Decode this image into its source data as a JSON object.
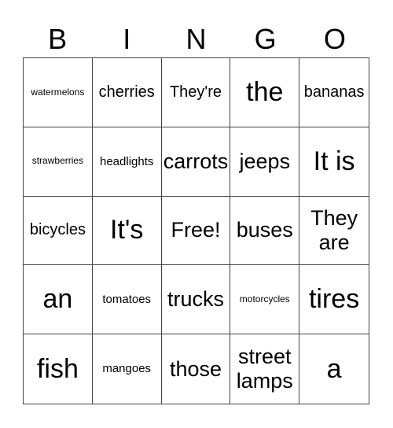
{
  "header": [
    "B",
    "I",
    "N",
    "G",
    "O"
  ],
  "cells": [
    {
      "text": "watermelons",
      "size": "xs"
    },
    {
      "text": "cherries",
      "size": "m"
    },
    {
      "text": "They're",
      "size": "m"
    },
    {
      "text": "the",
      "size": "xl"
    },
    {
      "text": "bananas",
      "size": "m"
    },
    {
      "text": "strawberries",
      "size": "xs"
    },
    {
      "text": "headlights",
      "size": "s"
    },
    {
      "text": "carrots",
      "size": "l"
    },
    {
      "text": "jeeps",
      "size": "l"
    },
    {
      "text": "It is",
      "size": "xl"
    },
    {
      "text": "bicycles",
      "size": "m"
    },
    {
      "text": "It's",
      "size": "xl"
    },
    {
      "text": "Free!",
      "size": "l"
    },
    {
      "text": "buses",
      "size": "l"
    },
    {
      "text": "They are",
      "size": "l"
    },
    {
      "text": "an",
      "size": "xl"
    },
    {
      "text": "tomatoes",
      "size": "s"
    },
    {
      "text": "trucks",
      "size": "l"
    },
    {
      "text": "motorcycles",
      "size": "xs"
    },
    {
      "text": "tires",
      "size": "xl"
    },
    {
      "text": "fish",
      "size": "xl"
    },
    {
      "text": "mangoes",
      "size": "s"
    },
    {
      "text": "those",
      "size": "l"
    },
    {
      "text": "street lamps",
      "size": "l"
    },
    {
      "text": "a",
      "size": "xl"
    }
  ]
}
